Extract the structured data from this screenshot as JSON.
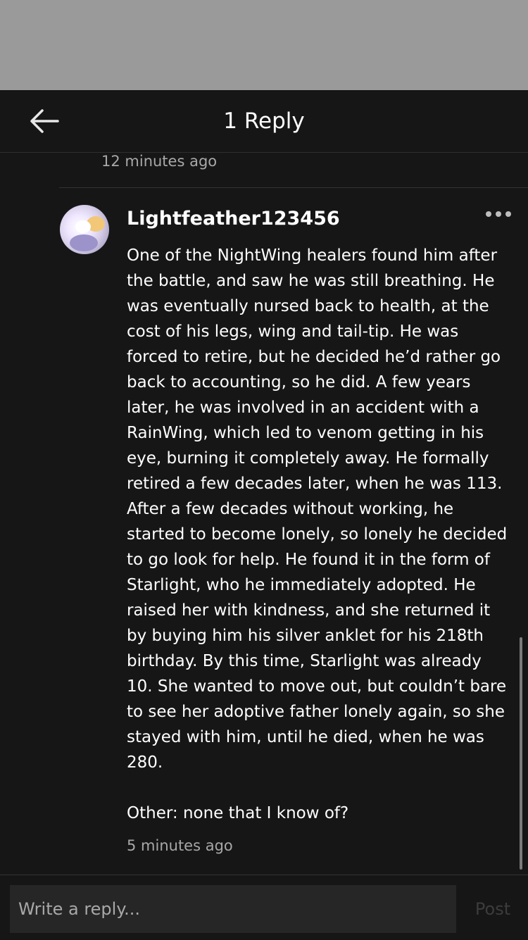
{
  "header": {
    "title": "1 Reply",
    "back_icon": "arrow-left-icon"
  },
  "parent_comment": {
    "time": "12 minutes ago"
  },
  "reply": {
    "avatar_icon": "user-avatar",
    "username": "Lightfeather123456",
    "more_icon": "more-horizontal-icon",
    "body": "One of the NightWing healers found him after\nthe battle, and saw he was still breathing. He\nwas eventually nursed back to health, at the\ncost of his legs, wing and tail-tip. He was\nforced to retire, but he decided he’d rather go\nback to accounting, so he did. A few years\nlater, he was involved in an accident with a\nRainWing, which led to venom getting in his\neye, burning it completely away. He formally\nretired a few decades later, when he was 113.\nAfter a few decades without working, he\nstarted to become lonely, so lonely he decided\nto go look for help. He found it in the form of\nStarlight, who he immediately adopted. He\nraised her with kindness, and she returned it\nby buying him his silver anklet for his 218th\nbirthday. By this time, Starlight was already\n10. She wanted to move out, but couldn’t bare\nto see her adoptive father lonely again, so she\nstayed with him, until he died, when he was\n280.\n\nOther: none that I know of?",
    "time": "5 minutes ago"
  },
  "composer": {
    "placeholder": "Write a reply...",
    "value": "",
    "post_label": "Post"
  },
  "colors": {
    "background": "#161616",
    "overlay": "#9a9a9a",
    "muted_text": "#a8a8a8",
    "input_background": "#262626",
    "post_disabled": "#3c3c3c"
  }
}
